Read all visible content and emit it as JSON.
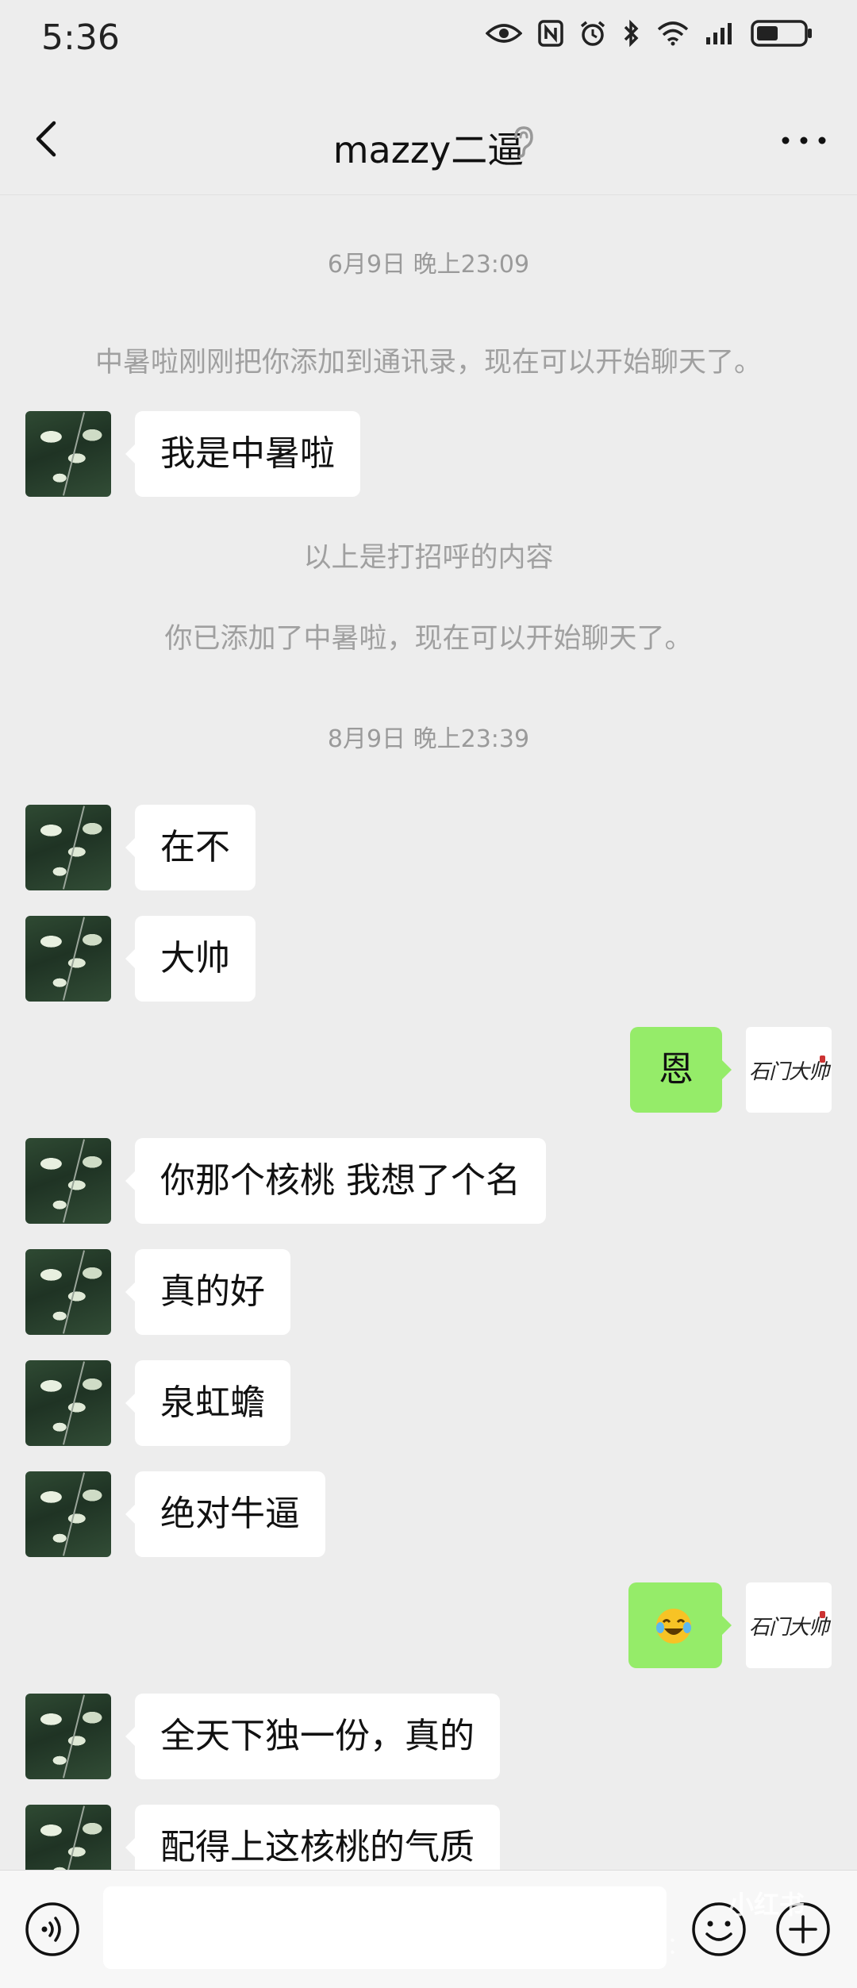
{
  "status_bar": {
    "time": "5:36"
  },
  "header": {
    "title": "mazzy二逼"
  },
  "chat": {
    "timestamps": [
      "6月9日 晚上23:09",
      "8月9日 晚上23:39"
    ],
    "system_messages": [
      "中暑啦刚刚把你添加到通讯录，现在可以开始聊天了。",
      "以上是打招呼的内容",
      "你已添加了中暑啦，现在可以开始聊天了。"
    ],
    "messages": [
      {
        "from": "contact",
        "text": "我是中暑啦"
      },
      {
        "from": "contact",
        "text": "在不"
      },
      {
        "from": "contact",
        "text": "大帅"
      },
      {
        "from": "me",
        "text": "恩"
      },
      {
        "from": "contact",
        "text": "你那个核桃 我想了个名"
      },
      {
        "from": "contact",
        "text": "真的好"
      },
      {
        "from": "contact",
        "text": "泉虹蟾"
      },
      {
        "from": "contact",
        "text": "绝对牛逼"
      },
      {
        "from": "me",
        "text": "",
        "emoji": "laughing-crying-face"
      },
      {
        "from": "contact",
        "text": "全天下独一份，真的"
      },
      {
        "from": "contact",
        "text": "配得上这核桃的气质"
      }
    ],
    "my_avatar_text": "石门大帅"
  },
  "input_bar": {
    "value": "",
    "placeholder": ""
  },
  "watermark": {
    "text": "小红书号：",
    "logo": "小红书"
  },
  "colors": {
    "background": "#ededed",
    "outgoing_bubble": "#95ec69",
    "incoming_bubble": "#ffffff"
  }
}
